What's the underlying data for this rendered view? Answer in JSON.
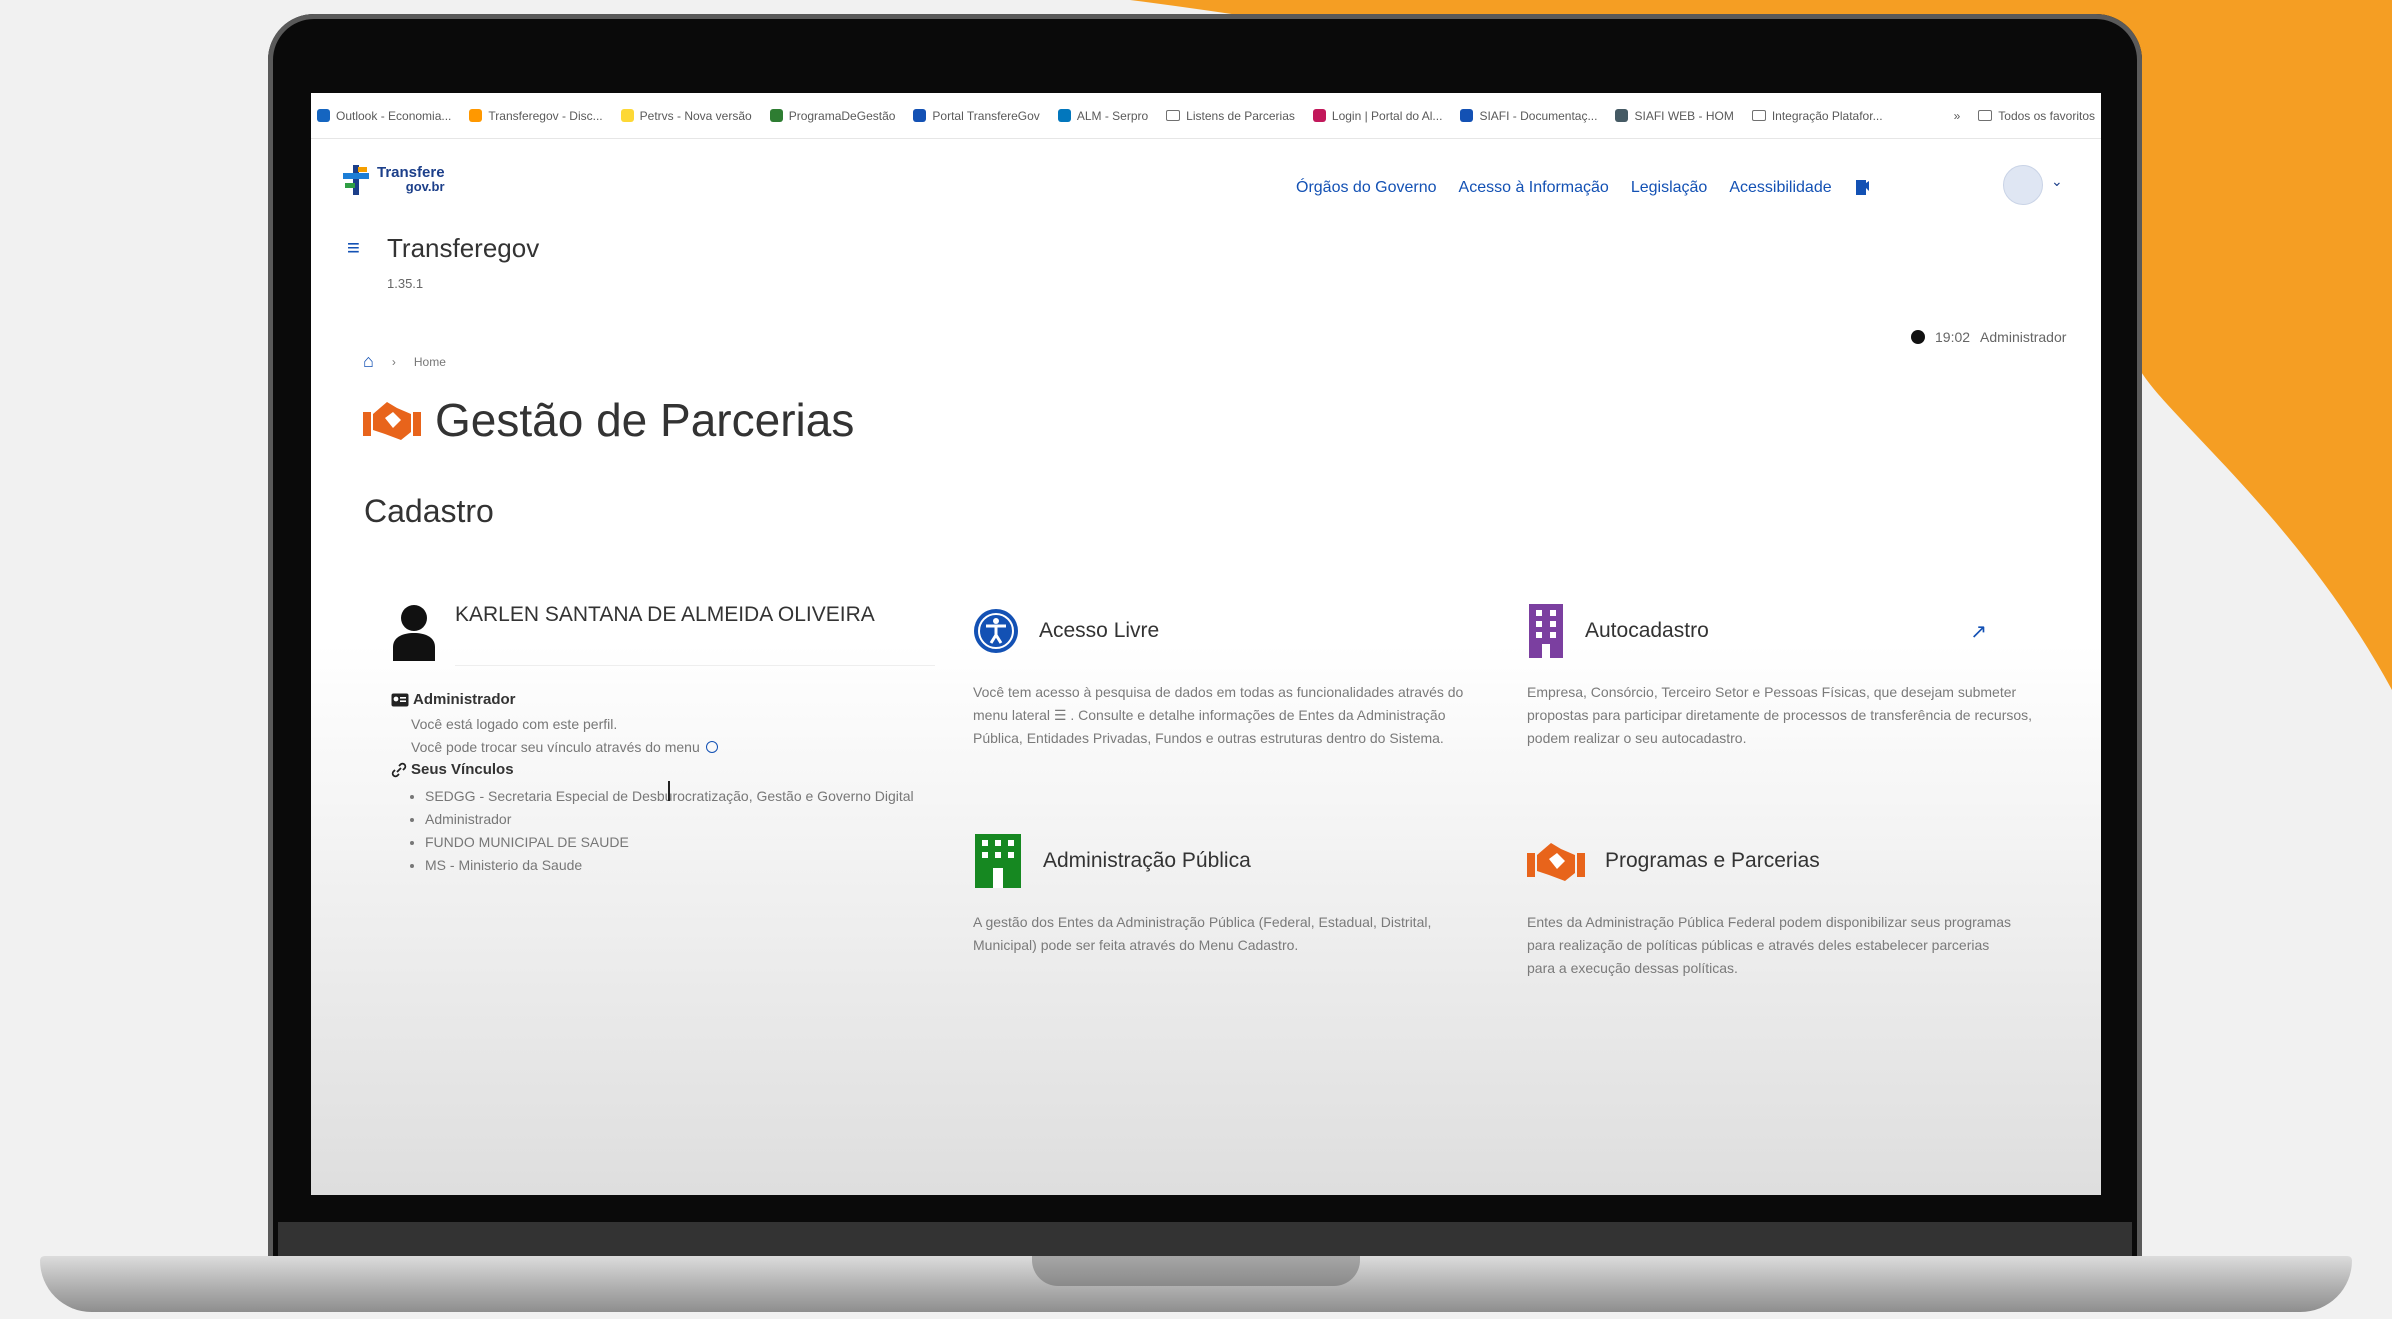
{
  "browser": {
    "bookmarks": [
      {
        "label": "Outlook - Economia...",
        "icon_color": "#1565c0",
        "kind": "site"
      },
      {
        "label": "Transferegov - Disc...",
        "icon_color": "#ff9800",
        "kind": "site"
      },
      {
        "label": "Petrvs - Nova versão",
        "icon_color": "#fdd835",
        "kind": "site"
      },
      {
        "label": "ProgramaDeGestão",
        "icon_color": "#2e7d32",
        "kind": "site"
      },
      {
        "label": "Portal TransfereGov",
        "icon_color": "#1351b4",
        "kind": "site"
      },
      {
        "label": "ALM - Serpro",
        "icon_color": "#0277bd",
        "kind": "site"
      },
      {
        "label": "Listens de Parcerias",
        "icon_color": "",
        "kind": "folder"
      },
      {
        "label": "Login | Portal do Al...",
        "icon_color": "#c2185b",
        "kind": "site"
      },
      {
        "label": "SIAFI - Documentaç...",
        "icon_color": "#1351b4",
        "kind": "site"
      },
      {
        "label": "SIAFI WEB - HOM",
        "icon_color": "#455a64",
        "kind": "site"
      },
      {
        "label": "Integração Platafor...",
        "icon_color": "",
        "kind": "folder"
      }
    ],
    "overflow": "»",
    "all_bookmarks": "Todos os favoritos"
  },
  "header": {
    "logo_top": "Transfere",
    "logo_bottom": "gov.br",
    "nav": [
      "Órgãos do Governo",
      "Acesso à Informação",
      "Legislação",
      "Acessibilidade"
    ]
  },
  "app": {
    "title": "Transferegov",
    "version": "1.35.1"
  },
  "session": {
    "time": "19:02",
    "role": "Administrador"
  },
  "breadcrumb": {
    "current": "Home"
  },
  "page": {
    "title": "Gestão de Parcerias",
    "section": "Cadastro"
  },
  "profile": {
    "name": "KARLEN SANTANA DE ALMEIDA OLIVEIRA",
    "role": "Administrador",
    "logged_text": "Você está logado com este perfil.",
    "switch_text": "Você pode trocar seu vínculo através do menu",
    "vinculos_label": "Seus Vínculos",
    "vinculos": [
      "SEDGG - Secretaria Especial de Desburocratização, Gestão e Governo Digital",
      "Administrador",
      "FUNDO MUNICIPAL DE SAUDE",
      "MS - Ministerio da Saude"
    ]
  },
  "cards": {
    "acesso_livre": {
      "title": "Acesso Livre",
      "desc": "Você tem acesso à pesquisa de dados em todas as funcionalidades através do menu lateral ☰ . Consulte e detalhe informações de Entes da Administração Pública, Entidades Privadas, Fundos e outras estruturas dentro do Sistema.",
      "color": "#1351b4"
    },
    "autocadastro": {
      "title": "Autocadastro",
      "desc": "Empresa, Consórcio, Terceiro Setor e Pessoas Físicas, que desejam submeter propostas para participar diretamente de processos de transferência de recursos, podem realizar o seu autocadastro.",
      "color": "#7b3fa0"
    },
    "administracao": {
      "title": "Administração Pública",
      "desc": "A gestão dos Entes da Administração Pública (Federal, Estadual, Distrital, Municipal) pode ser feita através do Menu Cadastro.",
      "color": "#168821"
    },
    "programas": {
      "title": "Programas e Parcerias",
      "desc": "Entes da Administração Pública Federal podem disponibilizar seus programas para realização de políticas públicas e através deles estabelecer parcerias para a execução dessas políticas.",
      "color": "#e8641b"
    }
  },
  "colors": {
    "accent": "#1351b4",
    "orange": "#f59e23"
  }
}
